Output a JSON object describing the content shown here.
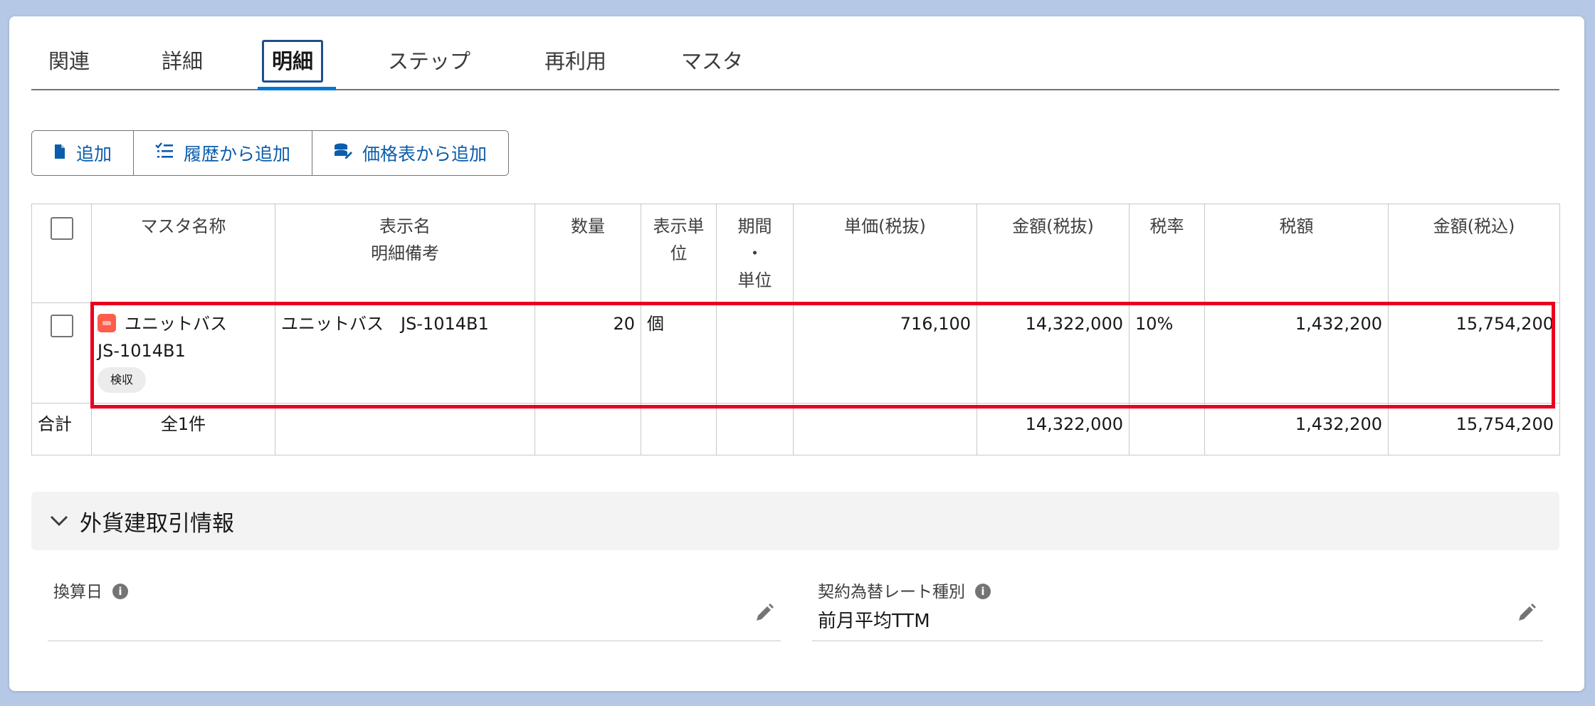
{
  "tabs": [
    {
      "label": "関連"
    },
    {
      "label": "詳細"
    },
    {
      "label": "明細"
    },
    {
      "label": "ステップ"
    },
    {
      "label": "再利用"
    },
    {
      "label": "マスタ"
    }
  ],
  "active_tab": "明細",
  "toolbar": {
    "add_label": "追加",
    "add_from_history_label": "履歴から追加",
    "add_from_pricelist_label": "価格表から追加"
  },
  "table": {
    "headers": {
      "master_name": "マスタ名称",
      "display_name_l1": "表示名",
      "display_name_l2": "明細備考",
      "quantity": "数量",
      "unit_l1": "表示単",
      "unit_l2": "位",
      "period_l1": "期間",
      "period_l2": "・",
      "period_l3": "単位",
      "unit_price": "単価(税抜)",
      "amount_ex": "金額(税抜)",
      "tax_rate": "税率",
      "tax_amount": "税額",
      "amount_in": "金額(税込)"
    },
    "rows": [
      {
        "master_name_l1": "ユニットバス",
        "master_name_l2": "JS-1014B1",
        "badge": "検収",
        "display_name": "ユニットバス　JS-1014B1",
        "quantity": "20",
        "unit": "個",
        "period": "",
        "unit_price": "716,100",
        "amount_ex": "14,322,000",
        "tax_rate": "10%",
        "tax_amount": "1,432,200",
        "amount_in": "15,754,200"
      }
    ],
    "total": {
      "label": "合計",
      "count": "全1件",
      "amount_ex": "14,322,000",
      "tax_amount": "1,432,200",
      "amount_in": "15,754,200"
    }
  },
  "section": {
    "title": "外貨建取引情報"
  },
  "fields": {
    "conversion_date": {
      "label": "換算日",
      "value": ""
    },
    "rate_type": {
      "label": "契約為替レート種別",
      "value": "前月平均TTM"
    }
  },
  "colors": {
    "accent": "#0176d3",
    "link": "#0b5cab",
    "highlight": "#ea001e",
    "product_icon": "#fe5c4c"
  },
  "icons": {
    "add": "document-icon",
    "history": "list-check-icon",
    "pricelist": "coins-icon",
    "edit": "pencil-icon",
    "info": "info-icon",
    "expand": "chevron-down-icon"
  }
}
